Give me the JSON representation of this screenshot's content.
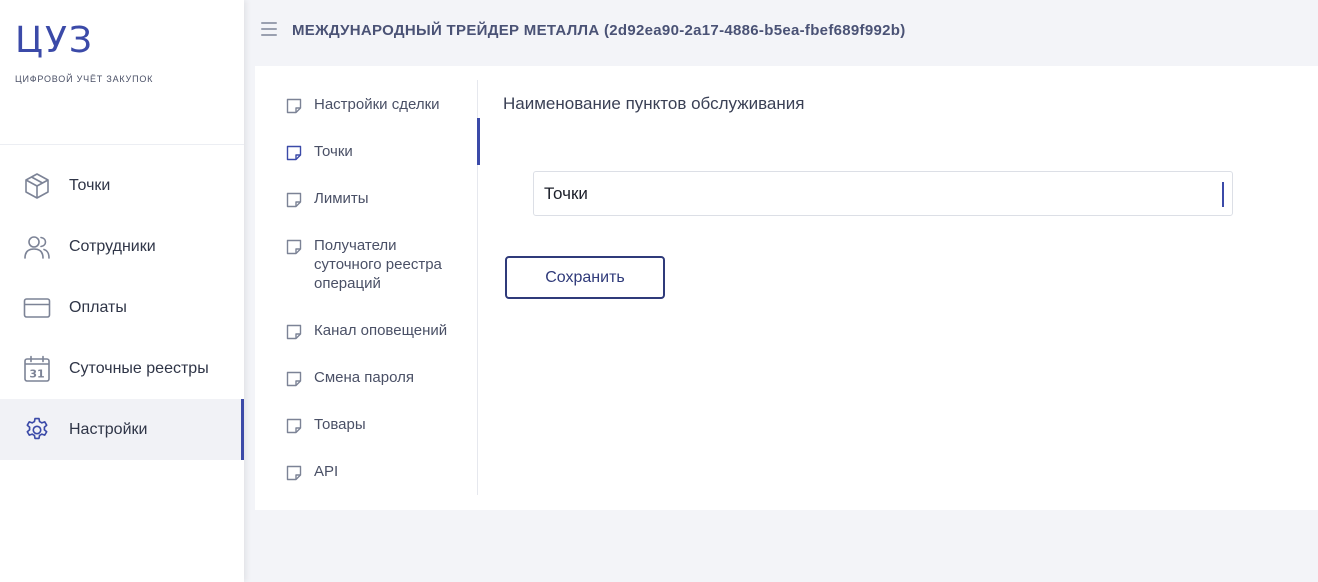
{
  "brand": {
    "logo": "ЦУЗ",
    "subtitle": "ЦИФРОВОЙ УЧЁТ ЗАКУПОК"
  },
  "sidebar": {
    "items": [
      {
        "label": "Точки",
        "icon": "cube-icon",
        "active": false
      },
      {
        "label": "Сотрудники",
        "icon": "users-icon",
        "active": false
      },
      {
        "label": "Оплаты",
        "icon": "card-icon",
        "active": false
      },
      {
        "label": "Суточные реестры",
        "icon": "calendar-icon",
        "active": false,
        "icon_text": "31"
      },
      {
        "label": "Настройки",
        "icon": "gear-icon",
        "active": true
      }
    ]
  },
  "header": {
    "company": "МЕЖДУНАРОДНЫЙ ТРЕЙДЕР МЕТАЛЛА (2d92ea90-2a17-4886-b5ea-fbef689f992b)"
  },
  "settings_nav": {
    "items": [
      {
        "label": "Настройки сделки"
      },
      {
        "label": "Точки",
        "active": true
      },
      {
        "label": "Лимиты"
      },
      {
        "label": "Получатели суточного реестра операций"
      },
      {
        "label": "Канал оповещений"
      },
      {
        "label": "Смена пароля"
      },
      {
        "label": "Товары"
      },
      {
        "label": "API"
      }
    ]
  },
  "main": {
    "section_title": "Наименование пунктов обслуживания",
    "name_input_value": "Точки",
    "save_label": "Сохранить"
  },
  "colors": {
    "accent": "#3b4aa8",
    "button_border": "#2f3a7a",
    "background": "#f3f4f8"
  }
}
